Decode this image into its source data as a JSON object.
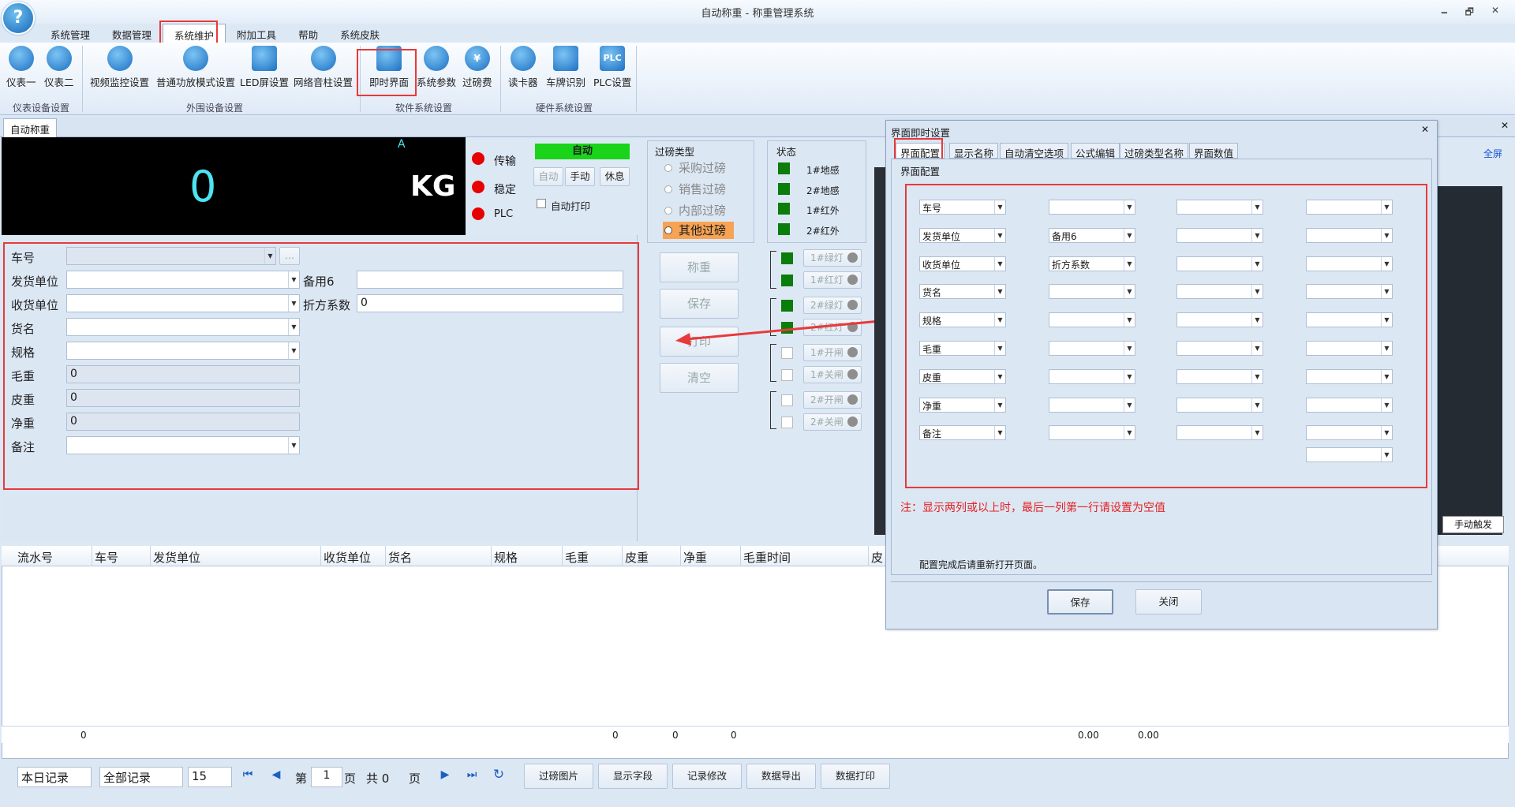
{
  "window": {
    "title": "自动称重 - 称重管理系统",
    "min": "🗕",
    "restore": "🗗",
    "close": "✕",
    "logo": "?"
  },
  "menu": [
    {
      "label": "系统管理"
    },
    {
      "label": "数据管理"
    },
    {
      "label": "系统维护"
    },
    {
      "label": "附加工具"
    },
    {
      "label": "帮助"
    },
    {
      "label": "系统皮肤"
    }
  ],
  "ribbon": {
    "buttons": [
      "仪表一",
      "仪表二",
      "视频监控设置",
      "普通功放模式设置",
      "LED屏设置",
      "网络音柱设置",
      "即时界面",
      "系统参数",
      "过磅费",
      "读卡器",
      "车牌识别",
      "PLC设置"
    ],
    "groups": [
      "仪表设备设置",
      "外围设备设置",
      "软件系统设置",
      "硬件系统设置"
    ],
    "plc_icon_text": "PLC",
    "fee_icon_text": "¥"
  },
  "tab": {
    "label": "自动称重",
    "close": "✕"
  },
  "display": {
    "weight": "0",
    "unit": "KG",
    "marker": "A"
  },
  "status_leds": [
    "传输",
    "稳定",
    "PLC"
  ],
  "mode": {
    "auto_label": "自动",
    "buttons": [
      "自动",
      "手动",
      "休息"
    ],
    "auto_print": "自动打印"
  },
  "weigh_type": {
    "title": "过磅类型",
    "options": [
      "采购过磅",
      "销售过磅",
      "内部过磅",
      "其他过磅"
    ]
  },
  "state": {
    "title": "状态",
    "items": [
      "1#地感",
      "2#地感",
      "1#红外",
      "2#红外"
    ]
  },
  "lights": [
    "1#绿灯",
    "1#红灯",
    "2#绿灯",
    "2#红灯",
    "1#开闸",
    "1#关闸",
    "2#开闸",
    "2#关闸"
  ],
  "actions": [
    "称重",
    "保存",
    "打印",
    "清空"
  ],
  "form": {
    "labels": [
      "车号",
      "发货单位",
      "收货单位",
      "货名",
      "规格",
      "毛重",
      "皮重",
      "净重",
      "备注"
    ],
    "values": {
      "gross": "0",
      "tare": "0",
      "net": "0"
    },
    "extra_labels": [
      "备用6",
      "折方系数"
    ],
    "extra_values": {
      "factor": "0"
    },
    "more_btn": "..."
  },
  "grid": {
    "headers": [
      "流水号",
      "车号",
      "发货单位",
      "收货单位",
      "货名",
      "规格",
      "毛重",
      "皮重",
      "净重",
      "毛重时间",
      "皮"
    ],
    "sums": [
      "0",
      "0",
      "0",
      "0",
      "0.00",
      "0.00"
    ]
  },
  "pager": {
    "range": "本日记录",
    "filter": "全部记录",
    "page_size": "15",
    "page_prefix": "第",
    "page": "1",
    "page_suffix": "页",
    "total": "共 0",
    "total_suffix": "页",
    "buttons": [
      "过磅图片",
      "显示字段",
      "记录修改",
      "数据导出",
      "数据打印"
    ]
  },
  "dialog": {
    "title": "界面即时设置",
    "close": "✕",
    "tabs": [
      "界面配置",
      "显示名称",
      "自动清空选项",
      "公式编辑",
      "过磅类型名称",
      "界面数值"
    ],
    "section": "界面配置",
    "col1": [
      "车号",
      "发货单位",
      "收货单位",
      "货名",
      "规格",
      "毛重",
      "皮重",
      "净重",
      "备注"
    ],
    "col2": [
      "",
      "备用6",
      "折方系数",
      "",
      "",
      "",
      "",
      "",
      ""
    ],
    "note": "注：显示两列或以上时，最后一列第一行请设置为空值",
    "hint": "配置完成后请重新打开页面。",
    "save": "保存",
    "close_btn": "关闭"
  },
  "right": {
    "fullscreen": "全屏",
    "manual_trigger": "手动触发",
    "close": "✕"
  },
  "colors": {
    "accent_red": "#e83a3a",
    "led_red": "#e60000",
    "green": "#0a7d0a",
    "auto_bg": "#19d419"
  }
}
